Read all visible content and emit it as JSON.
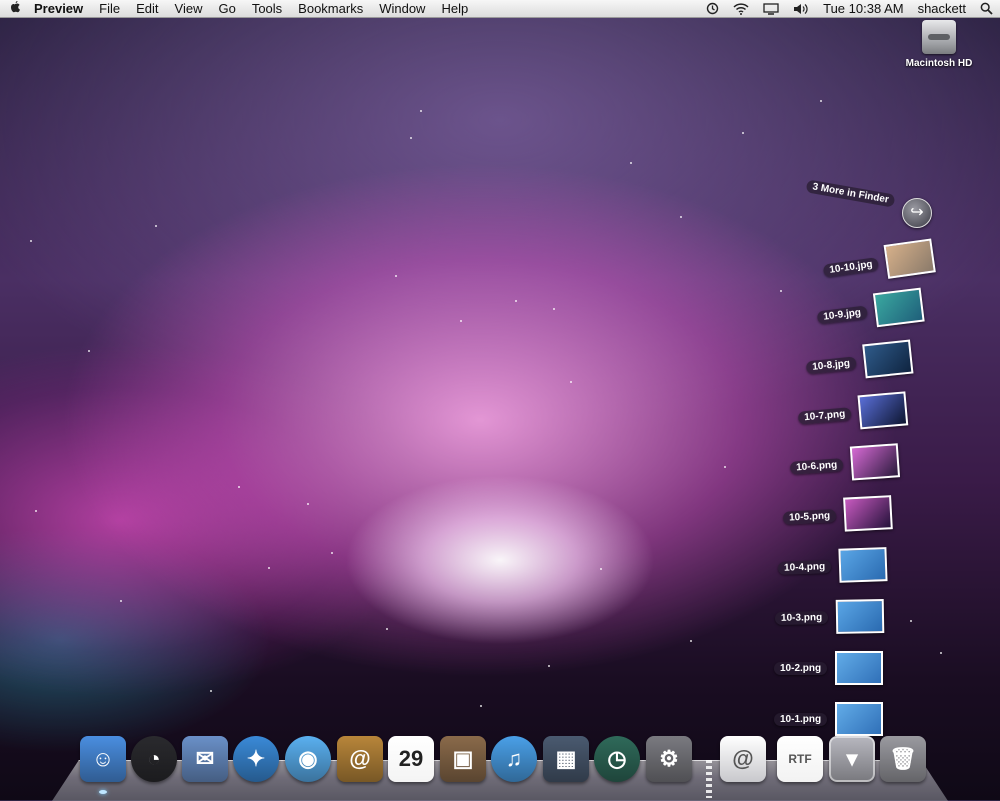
{
  "menubar": {
    "app_name": "Preview",
    "menus": [
      "File",
      "Edit",
      "View",
      "Go",
      "Tools",
      "Bookmarks",
      "Window",
      "Help"
    ],
    "status": {
      "icons": [
        "time-machine-icon",
        "wifi-icon",
        "display-icon",
        "volume-icon"
      ],
      "clock": "Tue 10:38 AM",
      "user": "shackett",
      "search_icon": "spotlight-icon"
    }
  },
  "desktop": {
    "hd_label": "Macintosh HD"
  },
  "stack": {
    "more_label": "3 More in Finder",
    "items": [
      {
        "label": "10-10.jpg",
        "colors": [
          "#d6b08a",
          "#8a7a6a"
        ]
      },
      {
        "label": "10-9.jpg",
        "colors": [
          "#3aa8a0",
          "#1f5f7a"
        ]
      },
      {
        "label": "10-8.jpg",
        "colors": [
          "#2f5b8a",
          "#0f2440"
        ]
      },
      {
        "label": "10-7.png",
        "colors": [
          "#5a6fd8",
          "#0d1530"
        ]
      },
      {
        "label": "10-6.png",
        "colors": [
          "#d66ad4",
          "#2a1a3c"
        ]
      },
      {
        "label": "10-5.png",
        "colors": [
          "#c85ac0",
          "#24123a"
        ]
      },
      {
        "label": "10-4.png",
        "colors": [
          "#5aa6e6",
          "#2a6ab0"
        ]
      },
      {
        "label": "10-3.png",
        "colors": [
          "#5aa6e6",
          "#2a6ab0"
        ]
      },
      {
        "label": "10-2.png",
        "colors": [
          "#62ace8",
          "#3070b8"
        ]
      },
      {
        "label": "10-1.png",
        "colors": [
          "#62ace8",
          "#3070b8"
        ]
      }
    ]
  },
  "dock": {
    "apps": [
      {
        "name": "finder-icon",
        "glyph": "☺",
        "color": "#4a8ee0",
        "running": true
      },
      {
        "name": "dashboard-icon",
        "glyph": "◔",
        "color": "#2a2a2e",
        "round": true
      },
      {
        "name": "mail-icon",
        "glyph": "✉",
        "color": "#6a90c8"
      },
      {
        "name": "safari-icon",
        "glyph": "✦",
        "color": "#3a8ad8",
        "round": true
      },
      {
        "name": "ichat-icon",
        "glyph": "◉",
        "color": "#5ab0f0",
        "round": true
      },
      {
        "name": "address-book-icon",
        "glyph": "@",
        "color": "#b8863a"
      },
      {
        "name": "ical-icon",
        "glyph": "29",
        "color": "#f4f4f4",
        "text_color": "#222"
      },
      {
        "name": "iphoto-icon",
        "glyph": "▣",
        "color": "#8a6a4a"
      },
      {
        "name": "itunes-icon",
        "glyph": "♫",
        "color": "#4aa0e8",
        "round": true
      },
      {
        "name": "spaces-icon",
        "glyph": "▦",
        "color": "#4a5a70"
      },
      {
        "name": "time-machine-icon",
        "glyph": "◷",
        "color": "#2f6a5a",
        "round": true
      },
      {
        "name": "system-preferences-icon",
        "glyph": "⚙",
        "color": "#7a7a80"
      },
      {
        "name": "downloads-stack-icon",
        "glyph": "@",
        "color": "#c8c8cc",
        "text_color": "#555"
      },
      {
        "name": "rtf-document-icon",
        "glyph": "RTF",
        "color": "#f2f2f2",
        "text_color": "#555"
      },
      {
        "name": "pictures-stack-icon",
        "glyph": "▾",
        "color": "#b8b8c0",
        "active": true
      },
      {
        "name": "trash-icon",
        "glyph": "🗑",
        "color": "#9a9aa0"
      }
    ]
  }
}
